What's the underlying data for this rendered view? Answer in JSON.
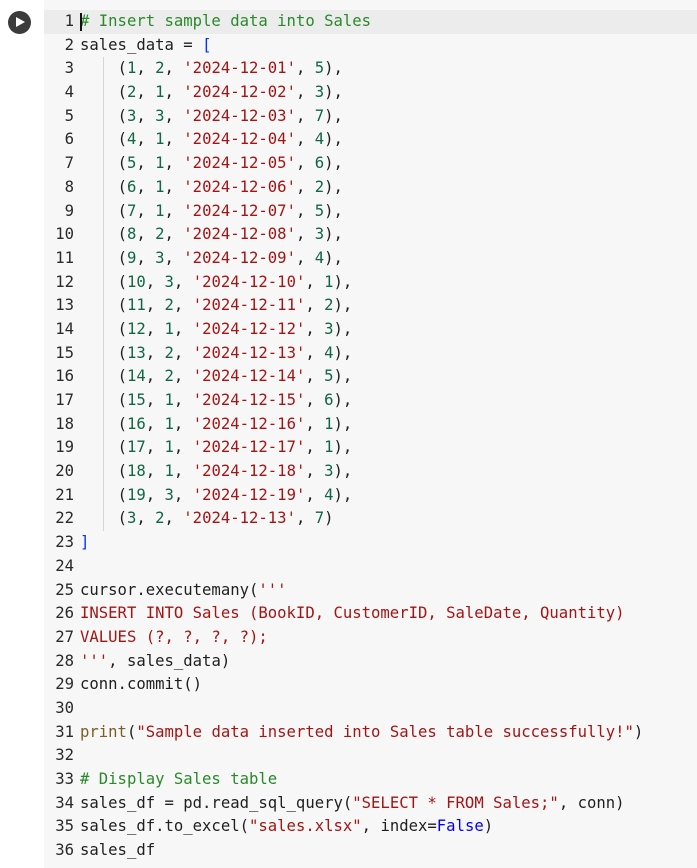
{
  "cell": {
    "run_button_label": "Run cell",
    "lines": [
      {
        "n": "1",
        "tokens": [
          {
            "t": "# Insert sample data into Sales",
            "c": "cm"
          }
        ]
      },
      {
        "n": "2",
        "tokens": [
          {
            "t": "sales_data = ",
            "c": ""
          },
          {
            "t": "[",
            "c": "br"
          }
        ]
      },
      {
        "n": "3",
        "tokens": [
          {
            "t": "    ",
            "c": ""
          },
          {
            "t": "(",
            "c": ""
          },
          {
            "t": "1",
            "c": "nm"
          },
          {
            "t": ", ",
            "c": ""
          },
          {
            "t": "2",
            "c": "nm"
          },
          {
            "t": ", ",
            "c": ""
          },
          {
            "t": "'2024-12-01'",
            "c": "st"
          },
          {
            "t": ", ",
            "c": ""
          },
          {
            "t": "5",
            "c": "nm"
          },
          {
            "t": "),",
            "c": ""
          }
        ]
      },
      {
        "n": "4",
        "tokens": [
          {
            "t": "    ",
            "c": ""
          },
          {
            "t": "(",
            "c": ""
          },
          {
            "t": "2",
            "c": "nm"
          },
          {
            "t": ", ",
            "c": ""
          },
          {
            "t": "1",
            "c": "nm"
          },
          {
            "t": ", ",
            "c": ""
          },
          {
            "t": "'2024-12-02'",
            "c": "st"
          },
          {
            "t": ", ",
            "c": ""
          },
          {
            "t": "3",
            "c": "nm"
          },
          {
            "t": "),",
            "c": ""
          }
        ]
      },
      {
        "n": "5",
        "tokens": [
          {
            "t": "    ",
            "c": ""
          },
          {
            "t": "(",
            "c": ""
          },
          {
            "t": "3",
            "c": "nm"
          },
          {
            "t": ", ",
            "c": ""
          },
          {
            "t": "3",
            "c": "nm"
          },
          {
            "t": ", ",
            "c": ""
          },
          {
            "t": "'2024-12-03'",
            "c": "st"
          },
          {
            "t": ", ",
            "c": ""
          },
          {
            "t": "7",
            "c": "nm"
          },
          {
            "t": "),",
            "c": ""
          }
        ]
      },
      {
        "n": "6",
        "tokens": [
          {
            "t": "    ",
            "c": ""
          },
          {
            "t": "(",
            "c": ""
          },
          {
            "t": "4",
            "c": "nm"
          },
          {
            "t": ", ",
            "c": ""
          },
          {
            "t": "1",
            "c": "nm"
          },
          {
            "t": ", ",
            "c": ""
          },
          {
            "t": "'2024-12-04'",
            "c": "st"
          },
          {
            "t": ", ",
            "c": ""
          },
          {
            "t": "4",
            "c": "nm"
          },
          {
            "t": "),",
            "c": ""
          }
        ]
      },
      {
        "n": "7",
        "tokens": [
          {
            "t": "    ",
            "c": ""
          },
          {
            "t": "(",
            "c": ""
          },
          {
            "t": "5",
            "c": "nm"
          },
          {
            "t": ", ",
            "c": ""
          },
          {
            "t": "1",
            "c": "nm"
          },
          {
            "t": ", ",
            "c": ""
          },
          {
            "t": "'2024-12-05'",
            "c": "st"
          },
          {
            "t": ", ",
            "c": ""
          },
          {
            "t": "6",
            "c": "nm"
          },
          {
            "t": "),",
            "c": ""
          }
        ]
      },
      {
        "n": "8",
        "tokens": [
          {
            "t": "    ",
            "c": ""
          },
          {
            "t": "(",
            "c": ""
          },
          {
            "t": "6",
            "c": "nm"
          },
          {
            "t": ", ",
            "c": ""
          },
          {
            "t": "1",
            "c": "nm"
          },
          {
            "t": ", ",
            "c": ""
          },
          {
            "t": "'2024-12-06'",
            "c": "st"
          },
          {
            "t": ", ",
            "c": ""
          },
          {
            "t": "2",
            "c": "nm"
          },
          {
            "t": "),",
            "c": ""
          }
        ]
      },
      {
        "n": "9",
        "tokens": [
          {
            "t": "    ",
            "c": ""
          },
          {
            "t": "(",
            "c": ""
          },
          {
            "t": "7",
            "c": "nm"
          },
          {
            "t": ", ",
            "c": ""
          },
          {
            "t": "1",
            "c": "nm"
          },
          {
            "t": ", ",
            "c": ""
          },
          {
            "t": "'2024-12-07'",
            "c": "st"
          },
          {
            "t": ", ",
            "c": ""
          },
          {
            "t": "5",
            "c": "nm"
          },
          {
            "t": "),",
            "c": ""
          }
        ]
      },
      {
        "n": "10",
        "tokens": [
          {
            "t": "    ",
            "c": ""
          },
          {
            "t": "(",
            "c": ""
          },
          {
            "t": "8",
            "c": "nm"
          },
          {
            "t": ", ",
            "c": ""
          },
          {
            "t": "2",
            "c": "nm"
          },
          {
            "t": ", ",
            "c": ""
          },
          {
            "t": "'2024-12-08'",
            "c": "st"
          },
          {
            "t": ", ",
            "c": ""
          },
          {
            "t": "3",
            "c": "nm"
          },
          {
            "t": "),",
            "c": ""
          }
        ]
      },
      {
        "n": "11",
        "tokens": [
          {
            "t": "    ",
            "c": ""
          },
          {
            "t": "(",
            "c": ""
          },
          {
            "t": "9",
            "c": "nm"
          },
          {
            "t": ", ",
            "c": ""
          },
          {
            "t": "3",
            "c": "nm"
          },
          {
            "t": ", ",
            "c": ""
          },
          {
            "t": "'2024-12-09'",
            "c": "st"
          },
          {
            "t": ", ",
            "c": ""
          },
          {
            "t": "4",
            "c": "nm"
          },
          {
            "t": "),",
            "c": ""
          }
        ]
      },
      {
        "n": "12",
        "tokens": [
          {
            "t": "    ",
            "c": ""
          },
          {
            "t": "(",
            "c": ""
          },
          {
            "t": "10",
            "c": "nm"
          },
          {
            "t": ", ",
            "c": ""
          },
          {
            "t": "3",
            "c": "nm"
          },
          {
            "t": ", ",
            "c": ""
          },
          {
            "t": "'2024-12-10'",
            "c": "st"
          },
          {
            "t": ", ",
            "c": ""
          },
          {
            "t": "1",
            "c": "nm"
          },
          {
            "t": "),",
            "c": ""
          }
        ]
      },
      {
        "n": "13",
        "tokens": [
          {
            "t": "    ",
            "c": ""
          },
          {
            "t": "(",
            "c": ""
          },
          {
            "t": "11",
            "c": "nm"
          },
          {
            "t": ", ",
            "c": ""
          },
          {
            "t": "2",
            "c": "nm"
          },
          {
            "t": ", ",
            "c": ""
          },
          {
            "t": "'2024-12-11'",
            "c": "st"
          },
          {
            "t": ", ",
            "c": ""
          },
          {
            "t": "2",
            "c": "nm"
          },
          {
            "t": "),",
            "c": ""
          }
        ]
      },
      {
        "n": "14",
        "tokens": [
          {
            "t": "    ",
            "c": ""
          },
          {
            "t": "(",
            "c": ""
          },
          {
            "t": "12",
            "c": "nm"
          },
          {
            "t": ", ",
            "c": ""
          },
          {
            "t": "1",
            "c": "nm"
          },
          {
            "t": ", ",
            "c": ""
          },
          {
            "t": "'2024-12-12'",
            "c": "st"
          },
          {
            "t": ", ",
            "c": ""
          },
          {
            "t": "3",
            "c": "nm"
          },
          {
            "t": "),",
            "c": ""
          }
        ]
      },
      {
        "n": "15",
        "tokens": [
          {
            "t": "    ",
            "c": ""
          },
          {
            "t": "(",
            "c": ""
          },
          {
            "t": "13",
            "c": "nm"
          },
          {
            "t": ", ",
            "c": ""
          },
          {
            "t": "2",
            "c": "nm"
          },
          {
            "t": ", ",
            "c": ""
          },
          {
            "t": "'2024-12-13'",
            "c": "st"
          },
          {
            "t": ", ",
            "c": ""
          },
          {
            "t": "4",
            "c": "nm"
          },
          {
            "t": "),",
            "c": ""
          }
        ]
      },
      {
        "n": "16",
        "tokens": [
          {
            "t": "    ",
            "c": ""
          },
          {
            "t": "(",
            "c": ""
          },
          {
            "t": "14",
            "c": "nm"
          },
          {
            "t": ", ",
            "c": ""
          },
          {
            "t": "2",
            "c": "nm"
          },
          {
            "t": ", ",
            "c": ""
          },
          {
            "t": "'2024-12-14'",
            "c": "st"
          },
          {
            "t": ", ",
            "c": ""
          },
          {
            "t": "5",
            "c": "nm"
          },
          {
            "t": "),",
            "c": ""
          }
        ]
      },
      {
        "n": "17",
        "tokens": [
          {
            "t": "    ",
            "c": ""
          },
          {
            "t": "(",
            "c": ""
          },
          {
            "t": "15",
            "c": "nm"
          },
          {
            "t": ", ",
            "c": ""
          },
          {
            "t": "1",
            "c": "nm"
          },
          {
            "t": ", ",
            "c": ""
          },
          {
            "t": "'2024-12-15'",
            "c": "st"
          },
          {
            "t": ", ",
            "c": ""
          },
          {
            "t": "6",
            "c": "nm"
          },
          {
            "t": "),",
            "c": ""
          }
        ]
      },
      {
        "n": "18",
        "tokens": [
          {
            "t": "    ",
            "c": ""
          },
          {
            "t": "(",
            "c": ""
          },
          {
            "t": "16",
            "c": "nm"
          },
          {
            "t": ", ",
            "c": ""
          },
          {
            "t": "1",
            "c": "nm"
          },
          {
            "t": ", ",
            "c": ""
          },
          {
            "t": "'2024-12-16'",
            "c": "st"
          },
          {
            "t": ", ",
            "c": ""
          },
          {
            "t": "1",
            "c": "nm"
          },
          {
            "t": "),",
            "c": ""
          }
        ]
      },
      {
        "n": "19",
        "tokens": [
          {
            "t": "    ",
            "c": ""
          },
          {
            "t": "(",
            "c": ""
          },
          {
            "t": "17",
            "c": "nm"
          },
          {
            "t": ", ",
            "c": ""
          },
          {
            "t": "1",
            "c": "nm"
          },
          {
            "t": ", ",
            "c": ""
          },
          {
            "t": "'2024-12-17'",
            "c": "st"
          },
          {
            "t": ", ",
            "c": ""
          },
          {
            "t": "1",
            "c": "nm"
          },
          {
            "t": "),",
            "c": ""
          }
        ]
      },
      {
        "n": "20",
        "tokens": [
          {
            "t": "    ",
            "c": ""
          },
          {
            "t": "(",
            "c": ""
          },
          {
            "t": "18",
            "c": "nm"
          },
          {
            "t": ", ",
            "c": ""
          },
          {
            "t": "1",
            "c": "nm"
          },
          {
            "t": ", ",
            "c": ""
          },
          {
            "t": "'2024-12-18'",
            "c": "st"
          },
          {
            "t": ", ",
            "c": ""
          },
          {
            "t": "3",
            "c": "nm"
          },
          {
            "t": "),",
            "c": ""
          }
        ]
      },
      {
        "n": "21",
        "tokens": [
          {
            "t": "    ",
            "c": ""
          },
          {
            "t": "(",
            "c": ""
          },
          {
            "t": "19",
            "c": "nm"
          },
          {
            "t": ", ",
            "c": ""
          },
          {
            "t": "3",
            "c": "nm"
          },
          {
            "t": ", ",
            "c": ""
          },
          {
            "t": "'2024-12-19'",
            "c": "st"
          },
          {
            "t": ", ",
            "c": ""
          },
          {
            "t": "4",
            "c": "nm"
          },
          {
            "t": "),",
            "c": ""
          }
        ]
      },
      {
        "n": "22",
        "tokens": [
          {
            "t": "    ",
            "c": ""
          },
          {
            "t": "(",
            "c": ""
          },
          {
            "t": "3",
            "c": "nm"
          },
          {
            "t": ", ",
            "c": ""
          },
          {
            "t": "2",
            "c": "nm"
          },
          {
            "t": ", ",
            "c": ""
          },
          {
            "t": "'2024-12-13'",
            "c": "st"
          },
          {
            "t": ", ",
            "c": ""
          },
          {
            "t": "7",
            "c": "nm"
          },
          {
            "t": ")",
            "c": ""
          }
        ]
      },
      {
        "n": "23",
        "tokens": [
          {
            "t": "]",
            "c": "br"
          }
        ]
      },
      {
        "n": "24",
        "tokens": []
      },
      {
        "n": "25",
        "tokens": [
          {
            "t": "cursor.executemany(",
            "c": ""
          },
          {
            "t": "'''",
            "c": "st"
          }
        ]
      },
      {
        "n": "26",
        "tokens": [
          {
            "t": "INSERT INTO Sales (BookID, CustomerID, SaleDate, Quantity)",
            "c": "st"
          }
        ]
      },
      {
        "n": "27",
        "tokens": [
          {
            "t": "VALUES (?, ?, ?, ?);",
            "c": "st"
          }
        ]
      },
      {
        "n": "28",
        "tokens": [
          {
            "t": "'''",
            "c": "st"
          },
          {
            "t": ", sales_data)",
            "c": ""
          }
        ]
      },
      {
        "n": "29",
        "tokens": [
          {
            "t": "conn.commit()",
            "c": ""
          }
        ]
      },
      {
        "n": "30",
        "tokens": []
      },
      {
        "n": "31",
        "tokens": [
          {
            "t": "print",
            "c": "bi"
          },
          {
            "t": "(",
            "c": ""
          },
          {
            "t": "\"Sample data inserted into Sales table successfully!\"",
            "c": "st"
          },
          {
            "t": ")",
            "c": ""
          }
        ]
      },
      {
        "n": "32",
        "tokens": []
      },
      {
        "n": "33",
        "tokens": [
          {
            "t": "# Display Sales table",
            "c": "cm"
          }
        ]
      },
      {
        "n": "34",
        "tokens": [
          {
            "t": "sales_df = pd.read_sql_query(",
            "c": ""
          },
          {
            "t": "\"SELECT * FROM Sales;\"",
            "c": "st"
          },
          {
            "t": ", conn)",
            "c": ""
          }
        ]
      },
      {
        "n": "35",
        "tokens": [
          {
            "t": "sales_df.to_excel(",
            "c": ""
          },
          {
            "t": "\"sales.xlsx\"",
            "c": "st"
          },
          {
            "t": ", index=",
            "c": ""
          },
          {
            "t": "False",
            "c": "kw"
          },
          {
            "t": ")",
            "c": ""
          }
        ]
      },
      {
        "n": "36",
        "tokens": [
          {
            "t": "sales_df",
            "c": ""
          }
        ]
      }
    ]
  },
  "colors": {
    "editor_bg": "#f7f7f7",
    "comment": "#298a2a",
    "keyword": "#0000ff",
    "number": "#116644",
    "string": "#a31515",
    "bracket": "#0431fa",
    "builtin": "#795e26"
  },
  "icons": {
    "run": "play-circle-icon"
  }
}
